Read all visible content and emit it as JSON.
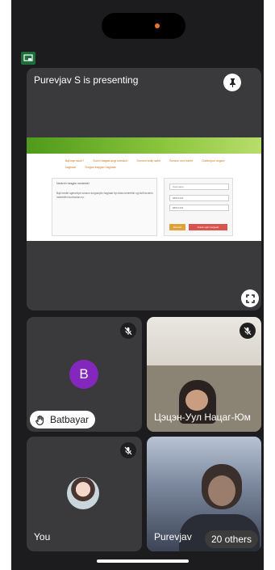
{
  "presenter": {
    "title": "Purevjav S is presenting",
    "shared_screen": {
      "crumbs": [
        "Bqt bqe asuh?",
        "Surch baigaa angi sonskoh",
        "Sonson bolip sahh",
        "Sonson ono eamh",
        "Gadbejuul ungani haghaar",
        "Surgan baygan haghaar"
      ],
      "panel_title": "Nevtreh hesgiin medeelel",
      "panel_text": "Bqk medle ugenchiye sonson surguulyiin haghaar bpi data nevtrehiin ug bolh tuvshin medeeliin tsorhuulan eu.",
      "fields": [
        "Username",
        "88831304",
        "88831304"
      ],
      "buttons": [
        "Nevtreh",
        "Nuuts ugiin sergeeh"
      ]
    }
  },
  "participants": [
    {
      "name": "Batbayar",
      "avatar_letter": "B",
      "hand_raised": true,
      "muted": true
    },
    {
      "name": "Цэцэн-Уул Нацаг-Юм",
      "muted": true
    },
    {
      "name": "You",
      "muted": true
    },
    {
      "name": "Purevjav",
      "muted": false
    }
  ],
  "others_label": "20 others",
  "colors": {
    "background": "#1c1c1e",
    "tile": "#3a3a3c",
    "avatar": "#8428bd",
    "cast_icon": "#1e6e3a"
  }
}
